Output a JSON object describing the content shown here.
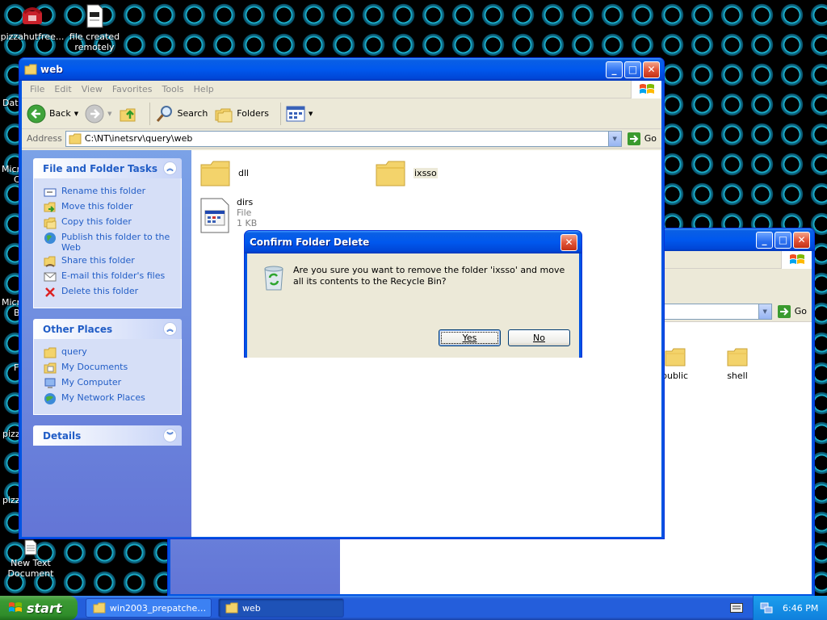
{
  "desktop": {
    "icons": [
      {
        "label": "pizzahutfree..."
      },
      {
        "label": "file created remotely"
      },
      {
        "label": "New Text Document"
      }
    ],
    "partial_labels": [
      "Data",
      "Micro",
      "C",
      "Micro",
      "B",
      "F",
      "pizz",
      "pizz"
    ]
  },
  "main_window": {
    "title": "web",
    "menu": [
      "File",
      "Edit",
      "View",
      "Favorites",
      "Tools",
      "Help"
    ],
    "toolbar": {
      "back": "Back",
      "search": "Search",
      "folders": "Folders"
    },
    "address": {
      "label": "Address",
      "value": "C:\\NT\\inetsrv\\query\\web",
      "go": "Go"
    },
    "tasks": {
      "title": "File and Folder Tasks",
      "items": [
        {
          "label": "Rename this folder",
          "icon": "rename-icon"
        },
        {
          "label": "Move this folder",
          "icon": "move-icon"
        },
        {
          "label": "Copy this folder",
          "icon": "copy-icon"
        },
        {
          "label": "Publish this folder to the Web",
          "icon": "publish-icon"
        },
        {
          "label": "Share this folder",
          "icon": "share-icon"
        },
        {
          "label": "E-mail this folder's files",
          "icon": "email-icon"
        },
        {
          "label": "Delete this folder",
          "icon": "delete-icon"
        }
      ]
    },
    "places": {
      "title": "Other Places",
      "items": [
        {
          "label": "query",
          "icon": "folder-icon"
        },
        {
          "label": "My Documents",
          "icon": "my-documents-icon"
        },
        {
          "label": "My Computer",
          "icon": "my-computer-icon"
        },
        {
          "label": "My Network Places",
          "icon": "network-icon"
        }
      ]
    },
    "details": {
      "title": "Details"
    },
    "files": [
      {
        "name": "dll",
        "type": "folder"
      },
      {
        "name": "ixsso",
        "type": "folder"
      },
      {
        "name": "dirs",
        "type": "file",
        "kind": "File",
        "size": "1 KB"
      }
    ]
  },
  "back_window": {
    "go": "Go",
    "files": [
      {
        "name": "public"
      },
      {
        "name": "shell"
      }
    ]
  },
  "dialog": {
    "title": "Confirm Folder Delete",
    "message": "Are you sure you want to remove the folder 'ixsso' and move all its contents to the Recycle Bin?",
    "yes": "Yes",
    "no": "No"
  },
  "taskbar": {
    "start": "start",
    "tasks": [
      {
        "label": "win2003_prepatched...",
        "active": false
      },
      {
        "label": "web",
        "active": true
      }
    ],
    "clock": "6:46 PM"
  },
  "colors": {
    "xp_blue": "#0054e3",
    "task_link": "#215dc6",
    "start_green": "#3c9a34"
  }
}
